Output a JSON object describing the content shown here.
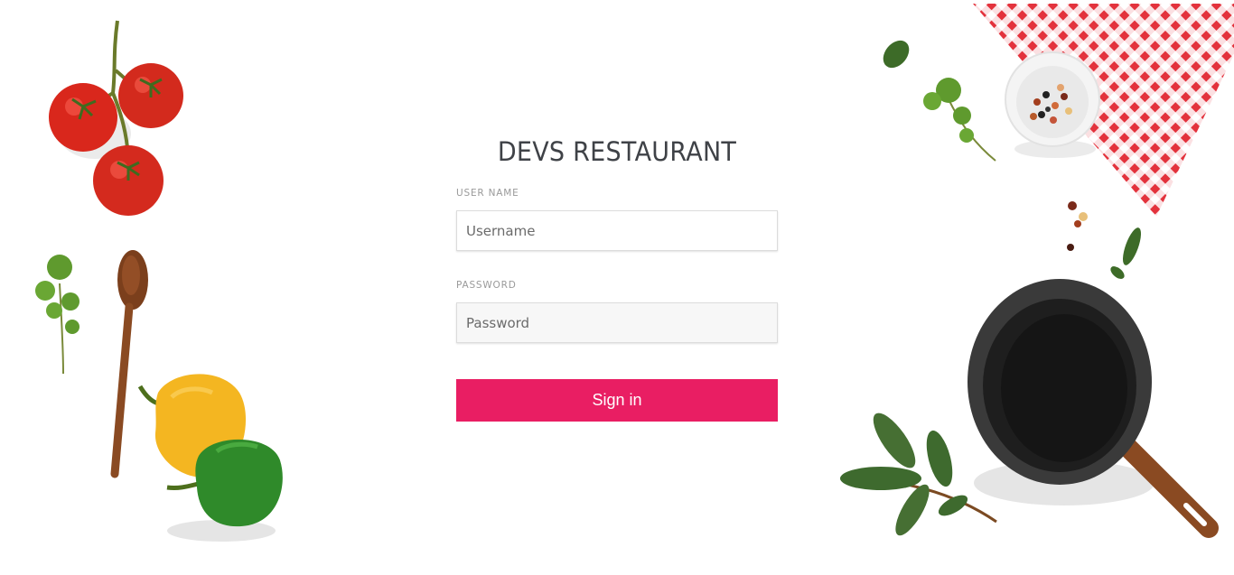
{
  "brand": {
    "title": "DEVS RESTAURANT"
  },
  "form": {
    "username_label": "USER NAME",
    "username_placeholder": "Username",
    "password_label": "PASSWORD",
    "password_placeholder": "Password",
    "signin_label": "Sign in"
  },
  "colors": {
    "accent": "#e91e63",
    "title": "#3f4247",
    "label": "#9a9a9a"
  },
  "decorations": [
    "tomato-vine",
    "parsley-sprig",
    "wooden-spoon",
    "yellow-pepper",
    "green-pepper",
    "checkered-napkin",
    "pepper-bowl",
    "basil-leaves",
    "bay-leaf-branch",
    "frying-pan"
  ]
}
